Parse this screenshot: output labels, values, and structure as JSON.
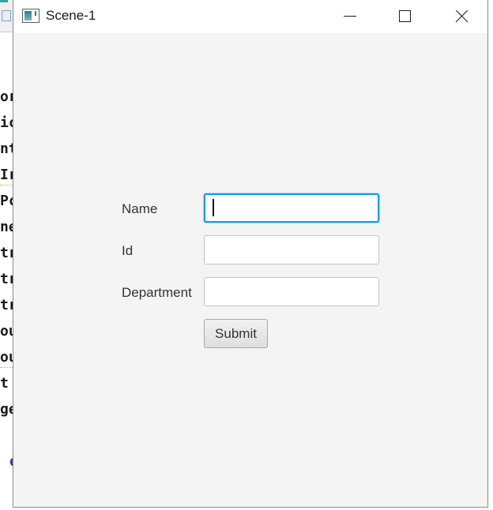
{
  "background_editor": {
    "code_fragments": [
      "or",
      "ic",
      "nt",
      "Ir",
      "Pc",
      "ne",
      "tr",
      "tr",
      "tr",
      "ou",
      "ou",
      "t",
      "ge",
      "e"
    ]
  },
  "window": {
    "title": "Scene-1",
    "icons": {
      "app": "app-icon",
      "minimize": "minimize-icon",
      "maximize": "maximize-icon",
      "close": "close-icon"
    }
  },
  "form": {
    "fields": [
      {
        "label": "Name",
        "value": "",
        "focused": true
      },
      {
        "label": "Id",
        "value": ""
      },
      {
        "label": "Department",
        "value": ""
      }
    ],
    "submit_label": "Submit"
  },
  "colors": {
    "focus_border": "#1a9ce0",
    "window_background": "#f4f4f4"
  }
}
